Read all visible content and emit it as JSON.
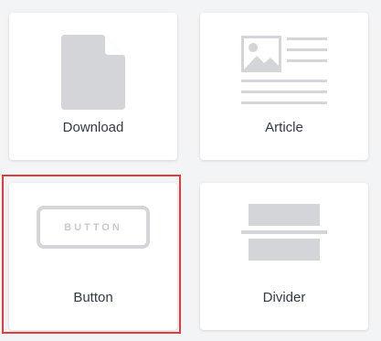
{
  "blocks": [
    {
      "label": "Download",
      "icon": "file-icon"
    },
    {
      "label": "Article",
      "icon": "article-icon"
    },
    {
      "label": "Button",
      "icon": "button-icon",
      "placeholder_text": "BUTTON",
      "selected": true
    },
    {
      "label": "Divider",
      "icon": "divider-icon"
    }
  ],
  "colors": {
    "background": "#f3f4f6",
    "card": "#ffffff",
    "icon": "#d3d5d8",
    "label": "#333a40",
    "selection": "#e23b3b"
  }
}
